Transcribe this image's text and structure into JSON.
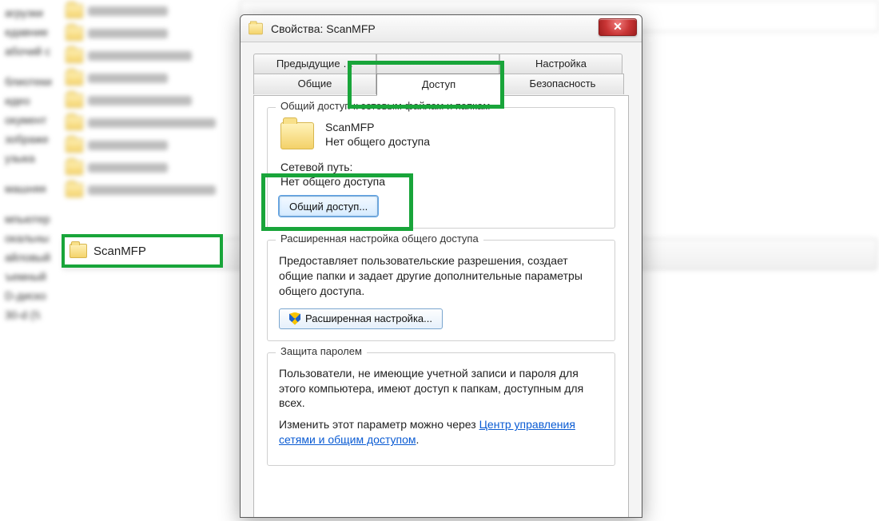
{
  "sidebar": {
    "items": [
      "агрузки",
      "едавние",
      "абочий с",
      "",
      "блиотеки",
      "идео",
      "окумент",
      "зображе",
      "узыка",
      "",
      "машняя",
      "",
      "мпьютер",
      "окальны",
      "айловый",
      "ъемный",
      "D-диско",
      "30-d (\\\\"
    ]
  },
  "selected_folder": {
    "name": "ScanMFP"
  },
  "dialog": {
    "title": "Свойства: ScanMFP",
    "tabs": {
      "row1": [
        "Предыдущие …",
        "",
        "Настройка"
      ],
      "row2": [
        "Общие",
        "Доступ",
        "Безопасность"
      ],
      "active": "Доступ"
    },
    "group1": {
      "title": "Общий доступ к сетевым файлам и папкам",
      "folder": "ScanMFP",
      "status": "Нет общего доступа",
      "net_label": "Сетевой путь:",
      "net_value": "Нет общего доступа",
      "share_btn": "Общий доступ..."
    },
    "group2": {
      "title": "Расширенная настройка общего доступа",
      "desc": "Предоставляет пользовательские разрешения, создает общие папки и задает другие дополнительные параметры общего доступа.",
      "btn": "Расширенная настройка..."
    },
    "group3": {
      "title": "Защита паролем",
      "l1": "Пользователи, не имеющие учетной записи и пароля для этого компьютера, имеют доступ к папкам, доступным для всех.",
      "l2a": "Изменить этот параметр можно через ",
      "link": "Центр управления сетями и общим доступом",
      "l2b": "."
    }
  }
}
